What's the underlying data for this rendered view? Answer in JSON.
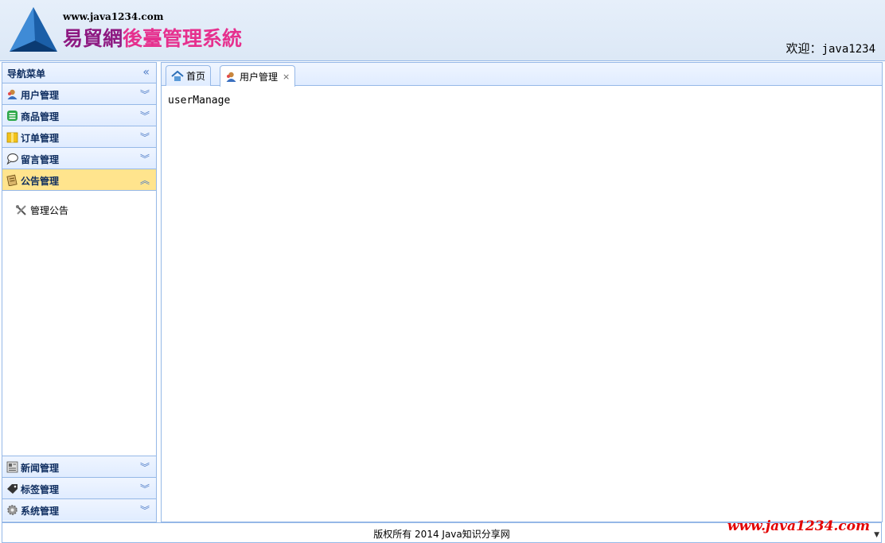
{
  "header": {
    "site_url": "www.java1234.com",
    "title_part1": "易貿網",
    "title_part2": "後臺管理系統",
    "welcome_label": "欢迎：",
    "username": "java1234"
  },
  "sidebar": {
    "title": "导航菜单",
    "collapse_icon": "double-chevron-left-icon",
    "items": [
      {
        "label": "用户管理",
        "icon": "user-icon"
      },
      {
        "label": "商品管理",
        "icon": "list-icon"
      },
      {
        "label": "订单管理",
        "icon": "folder-icon"
      },
      {
        "label": "留言管理",
        "icon": "speech-bubble-icon"
      },
      {
        "label": "公告管理",
        "icon": "notepad-icon",
        "expanded": true
      },
      {
        "label": "新闻管理",
        "icon": "newspaper-icon"
      },
      {
        "label": "标签管理",
        "icon": "tag-icon"
      },
      {
        "label": "系统管理",
        "icon": "gear-icon"
      }
    ],
    "sub_items": [
      {
        "label": "管理公告",
        "icon": "tools-icon"
      }
    ]
  },
  "tabs": [
    {
      "label": "首页",
      "icon": "home-icon",
      "closable": false
    },
    {
      "label": "用户管理",
      "icon": "user-icon",
      "closable": true,
      "active": true
    }
  ],
  "tab_close_glyph": "×",
  "content": {
    "text": "userManage"
  },
  "footer": {
    "copyright": "版权所有 2014 Java知识分享网",
    "watermark": "www.java1234.com"
  },
  "colors": {
    "border": "#95b8e7",
    "selected_row": "#ffe48d",
    "brand_purple": "#8e1a82",
    "brand_pink": "#e6308e",
    "watermark_red": "#e30000"
  }
}
